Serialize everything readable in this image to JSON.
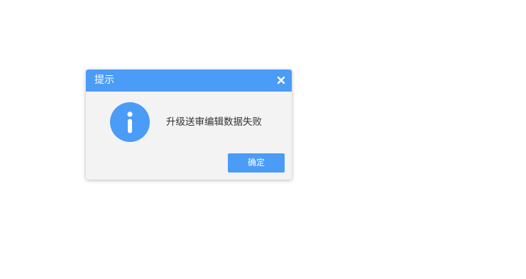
{
  "dialog": {
    "title": "提示",
    "close_icon": "close-icon",
    "status_icon": "info-icon",
    "message": "升级送审编辑数据失败",
    "ok_label": "确定"
  },
  "colors": {
    "accent": "#4a9cf7",
    "dialog_body": "#f3f3f3",
    "text": "#333333",
    "page_background": "#ffffff"
  }
}
